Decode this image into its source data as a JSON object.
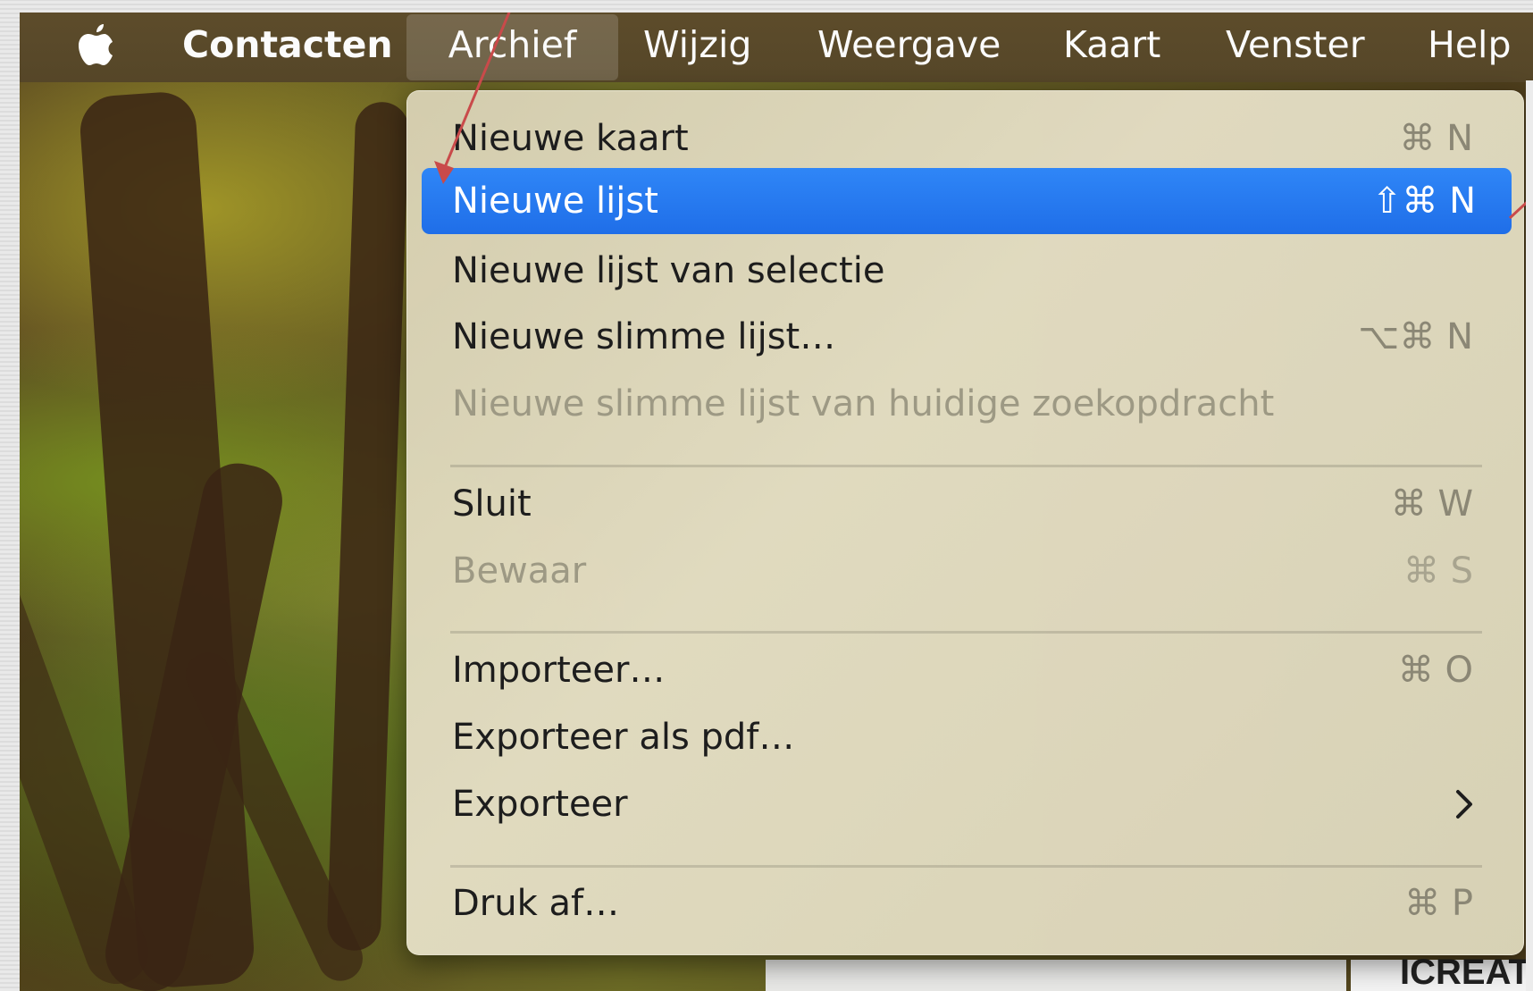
{
  "menubar": {
    "app_name": "Contacten",
    "items": [
      "Archief",
      "Wijzig",
      "Weergave",
      "Kaart",
      "Venster",
      "Help"
    ]
  },
  "menu": {
    "items": [
      {
        "label": "Nieuwe kaart",
        "shortcut": "⌘ N"
      },
      {
        "label": "Nieuwe lijst",
        "shortcut": "⇧⌘ N",
        "selected": true
      },
      {
        "label": "Nieuwe lijst van selectie",
        "shortcut": ""
      },
      {
        "label": "Nieuwe slimme lijst…",
        "shortcut": "⌥⌘ N"
      },
      {
        "label": "Nieuwe slimme lijst van huidige zoekopdracht",
        "shortcut": "",
        "disabled": true
      },
      {
        "label": "Sluit",
        "shortcut": "⌘ W"
      },
      {
        "label": "Bewaar",
        "shortcut": "⌘ S",
        "disabled": true
      },
      {
        "label": "Importeer…",
        "shortcut": "⌘ O"
      },
      {
        "label": "Exporteer als pdf…",
        "shortcut": ""
      },
      {
        "label": "Exporteer",
        "shortcut": "",
        "submenu_icon": "chevron-right-icon"
      },
      {
        "label": "Druk af…",
        "shortcut": "⌘ P"
      }
    ]
  },
  "background": {
    "partial_text": "ICREATE"
  },
  "colors": {
    "highlight": "#2f86f7",
    "annotation_arrow": "#c94a4a",
    "menubar": "#5d4c2b"
  }
}
